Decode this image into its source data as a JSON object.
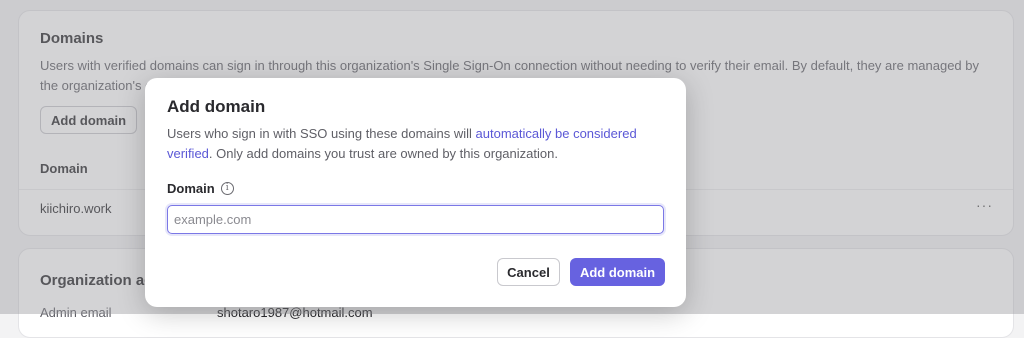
{
  "background": {
    "domains_section": {
      "title": "Domains",
      "description": "Users with verified domains can sign in through this organization's Single Sign-On connection without needing to verify their email. By default, they are managed by the organization's domain policy.",
      "add_button_label": "Add domain",
      "column_header": "Domain",
      "rows": [
        {
          "domain": "kiichiro.work",
          "menu_label": "···"
        }
      ]
    },
    "org_section": {
      "title": "Organization admins",
      "admin_email_label": "Admin email",
      "admin_email_value": "shotaro1987@hotmail.com"
    }
  },
  "modal": {
    "title": "Add domain",
    "description_before_link": "Users who sign in with SSO using these domains will ",
    "description_link": "automatically be considered verified",
    "description_after_link": ". Only add domains you trust are owned by this organization.",
    "field_label": "Domain",
    "info_icon_glyph": "i",
    "input_value": "",
    "input_placeholder": "example.com",
    "cancel_label": "Cancel",
    "submit_label": "Add domain"
  },
  "colors": {
    "accent": "#6762e0",
    "link": "#5b58d6",
    "overlay": "rgba(150,150,156,0.42)"
  }
}
